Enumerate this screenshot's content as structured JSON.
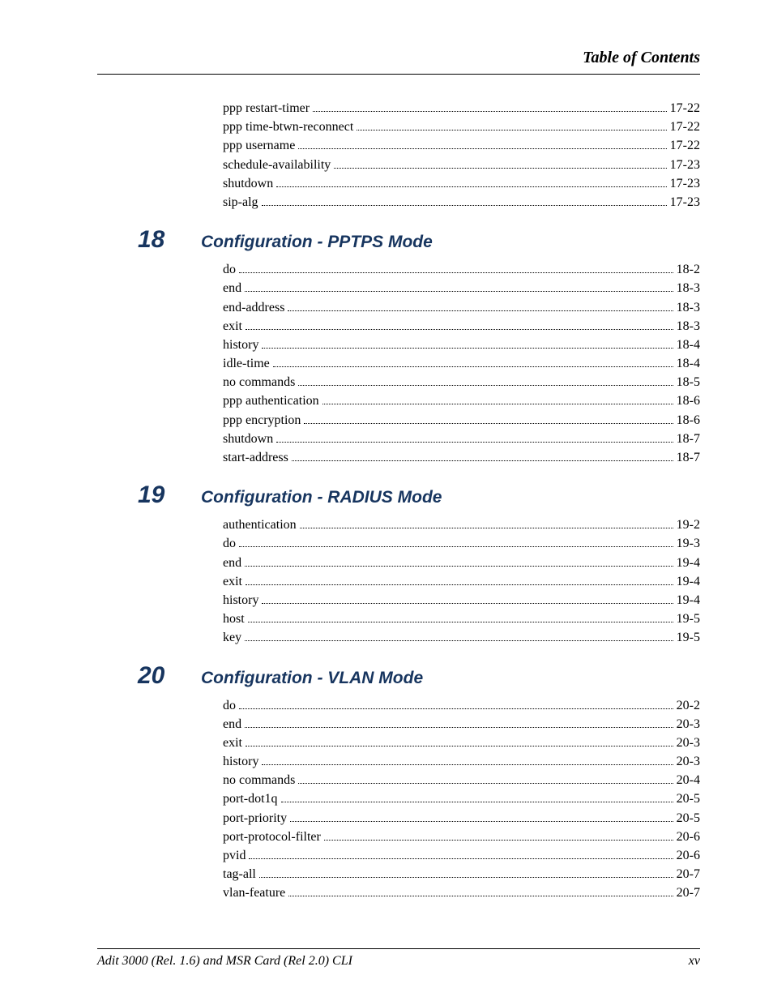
{
  "header_title": "Table of Contents",
  "footer": {
    "left": "Adit 3000 (Rel. 1.6) and MSR Card (Rel 2.0) CLI",
    "right": "xv"
  },
  "pre_entries": [
    {
      "label": "ppp restart-timer",
      "page": "17-22"
    },
    {
      "label": "ppp time-btwn-reconnect",
      "page": "17-22"
    },
    {
      "label": "ppp username",
      "page": "17-22"
    },
    {
      "label": "schedule-availability",
      "page": "17-23"
    },
    {
      "label": "shutdown",
      "page": "17-23"
    },
    {
      "label": "sip-alg",
      "page": "17-23"
    }
  ],
  "chapters": [
    {
      "num": "18",
      "title": "Configuration - PPTPS Mode",
      "entries": [
        {
          "label": "do",
          "page": "18-2"
        },
        {
          "label": "end",
          "page": "18-3"
        },
        {
          "label": "end-address",
          "page": "18-3"
        },
        {
          "label": "exit",
          "page": "18-3"
        },
        {
          "label": "history",
          "page": "18-4"
        },
        {
          "label": "idle-time",
          "page": "18-4"
        },
        {
          "label": "no commands",
          "page": "18-5"
        },
        {
          "label": "ppp authentication",
          "page": "18-6"
        },
        {
          "label": "ppp encryption",
          "page": "18-6"
        },
        {
          "label": "shutdown",
          "page": "18-7"
        },
        {
          "label": "start-address",
          "page": "18-7"
        }
      ]
    },
    {
      "num": "19",
      "title": "Configuration - RADIUS Mode",
      "entries": [
        {
          "label": "authentication",
          "page": "19-2"
        },
        {
          "label": "do",
          "page": "19-3"
        },
        {
          "label": "end",
          "page": "19-4"
        },
        {
          "label": "exit",
          "page": "19-4"
        },
        {
          "label": "history",
          "page": "19-4"
        },
        {
          "label": "host",
          "page": "19-5"
        },
        {
          "label": "key",
          "page": "19-5"
        }
      ]
    },
    {
      "num": "20",
      "title": "Configuration - VLAN Mode",
      "entries": [
        {
          "label": "do",
          "page": "20-2"
        },
        {
          "label": "end",
          "page": "20-3"
        },
        {
          "label": "exit",
          "page": "20-3"
        },
        {
          "label": "history",
          "page": "20-3"
        },
        {
          "label": "no commands",
          "page": "20-4"
        },
        {
          "label": "port-dot1q",
          "page": "20-5"
        },
        {
          "label": "port-priority",
          "page": "20-5"
        },
        {
          "label": "port-protocol-filter",
          "page": "20-6"
        },
        {
          "label": "pvid",
          "page": "20-6"
        },
        {
          "label": "tag-all",
          "page": "20-7"
        },
        {
          "label": "vlan-feature",
          "page": "20-7"
        }
      ]
    }
  ]
}
